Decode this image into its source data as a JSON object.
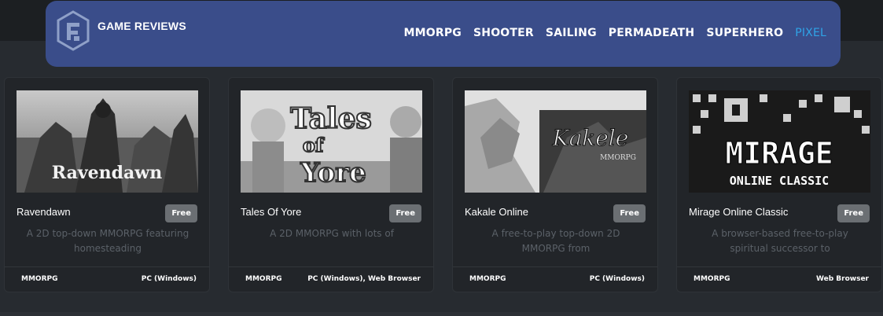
{
  "brand": {
    "name": "GAME REVIEWS",
    "logo_icon": "hexagon-g-logo-icon"
  },
  "nav": [
    {
      "label": "MMORPG",
      "active": false
    },
    {
      "label": "SHOOTER",
      "active": false
    },
    {
      "label": "SAILING",
      "active": false
    },
    {
      "label": "PERMADEATH",
      "active": false
    },
    {
      "label": "SUPERHERO",
      "active": false
    },
    {
      "label": "PIXEL",
      "active": true
    }
  ],
  "colors": {
    "navbar": "#3a4d8a",
    "accent": "#2fa4e7",
    "background": "#272b30",
    "card": "#222529"
  },
  "cards": [
    {
      "title": "Ravendawn",
      "badge": "Free",
      "description": "A 2D top-down MMORPG featuring homesteading",
      "genre": "MMORPG",
      "platform": "PC (Windows)",
      "thumb_text": "Ravendawn"
    },
    {
      "title": "Tales Of Yore",
      "badge": "Free",
      "description": "A 2D MMORPG with lots of",
      "genre": "MMORPG",
      "platform": "PC (Windows), Web Browser",
      "thumb_text_1": "Tales",
      "thumb_text_2": "of",
      "thumb_text_3": "Yore"
    },
    {
      "title": "Kakale Online",
      "badge": "Free",
      "description": "A free-to-play top-down 2D MMORPG from",
      "genre": "MMORPG",
      "platform": "PC (Windows)",
      "thumb_text_1": "Kakele",
      "thumb_text_2": "MMORPG"
    },
    {
      "title": "Mirage Online Classic",
      "badge": "Free",
      "description": "A browser-based free-to-play spiritual successor to",
      "genre": "MMORPG",
      "platform": "Web Browser",
      "thumb_text_1": "MIRAGE",
      "thumb_text_2": "ONLINE CLASSIC"
    }
  ]
}
